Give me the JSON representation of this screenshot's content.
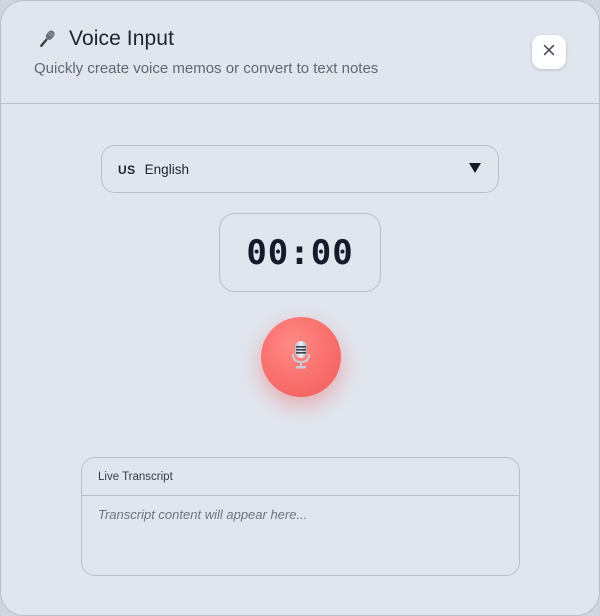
{
  "header": {
    "title": "Voice Input",
    "subtitle": "Quickly create voice memos or convert to text notes",
    "title_icon": "microphone-icon",
    "close_icon": "close-icon"
  },
  "language": {
    "flag": "US",
    "label": "English",
    "caret_icon": "caret-down-icon"
  },
  "timer": {
    "display": "00:00"
  },
  "record": {
    "icon": "microphone-icon",
    "color": "#f86c6a"
  },
  "transcript": {
    "title": "Live Transcript",
    "placeholder": "Transcript content will appear here..."
  }
}
